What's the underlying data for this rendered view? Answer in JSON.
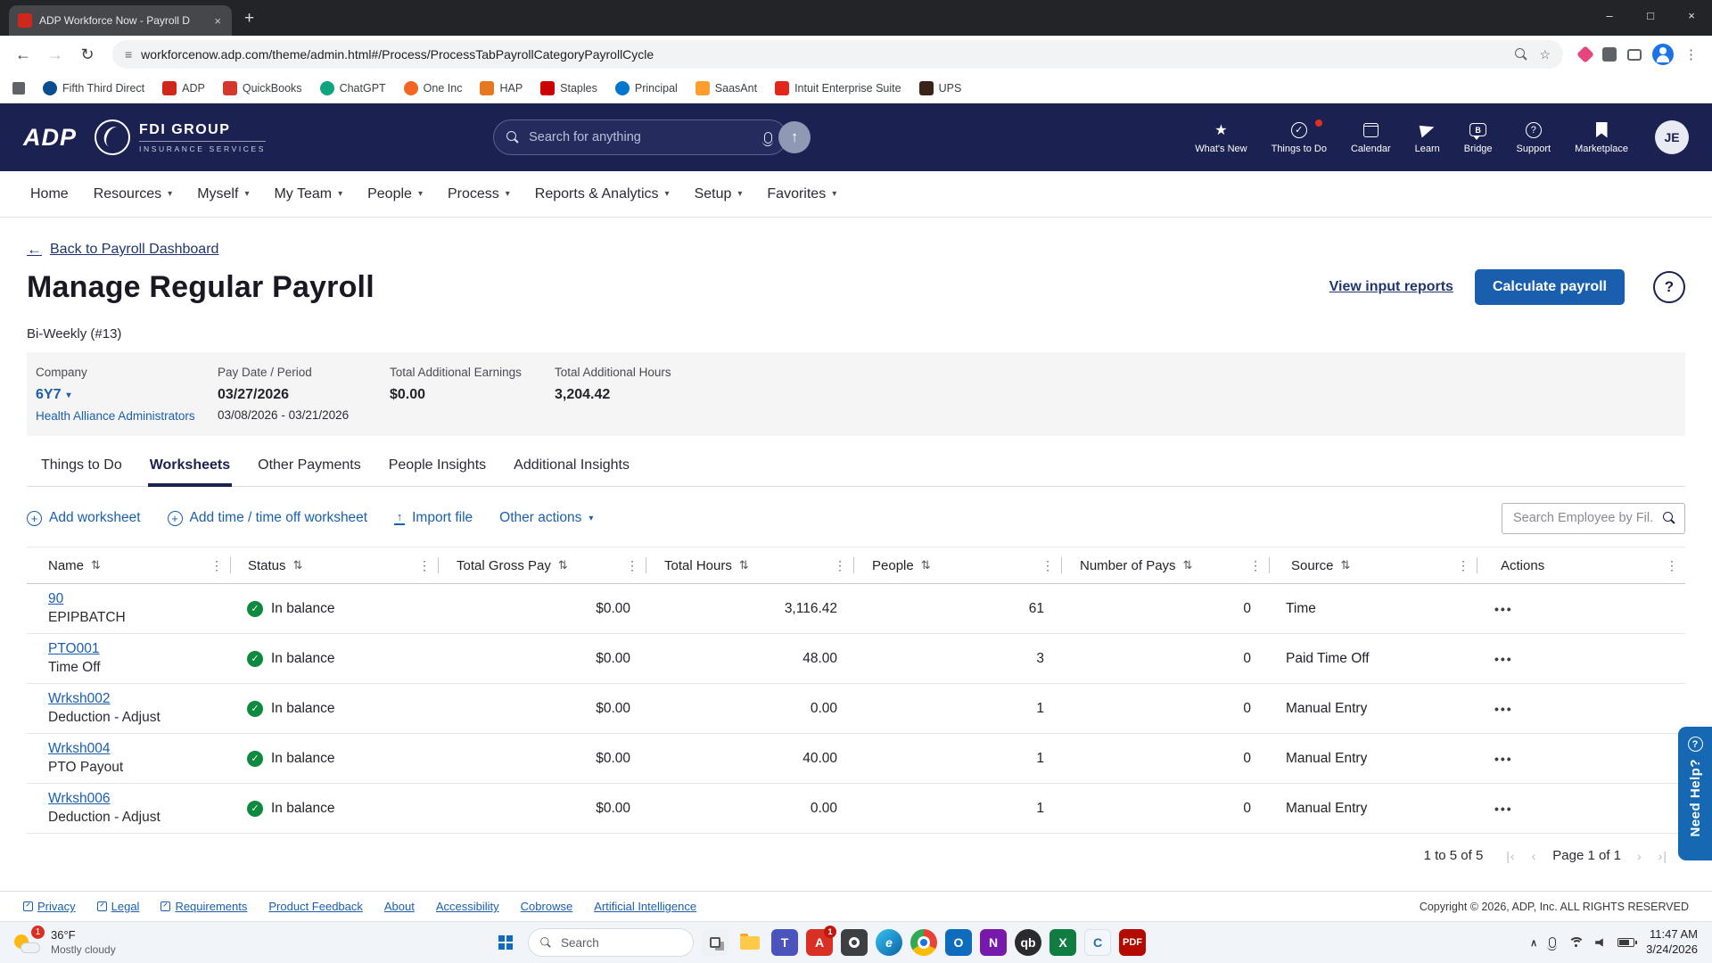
{
  "browser": {
    "tab_title": "ADP Workforce Now - Payroll D",
    "url": "workforcenow.adp.com/theme/admin.html#/Process/ProcessTabPayrollCategoryPayrollCycle"
  },
  "bookmarks": {
    "items": [
      "Fifth Third Direct",
      "ADP",
      "QuickBooks",
      "ChatGPT",
      "One Inc",
      "HAP",
      "Staples",
      "Principal",
      "SaasAnt",
      "Intuit Enterprise Suite",
      "UPS"
    ]
  },
  "header": {
    "logo_text": "ADP",
    "brand_name": "FDI GROUP",
    "brand_tagline": "INSURANCE SERVICES",
    "search_placeholder": "Search for anything",
    "menu": [
      {
        "label": "What's New"
      },
      {
        "label": "Things to Do",
        "has_badge": true
      },
      {
        "label": "Calendar"
      },
      {
        "label": "Learn"
      },
      {
        "label": "Bridge"
      },
      {
        "label": "Support"
      },
      {
        "label": "Marketplace"
      }
    ],
    "avatar_initials": "JE"
  },
  "nav": {
    "items": [
      {
        "label": "Home",
        "caret": false
      },
      {
        "label": "Resources",
        "caret": true
      },
      {
        "label": "Myself",
        "caret": true
      },
      {
        "label": "My Team",
        "caret": true
      },
      {
        "label": "People",
        "caret": true
      },
      {
        "label": "Process",
        "caret": true
      },
      {
        "label": "Reports & Analytics",
        "caret": true
      },
      {
        "label": "Setup",
        "caret": true
      },
      {
        "label": "Favorites",
        "caret": true
      }
    ]
  },
  "page": {
    "back_link": "Back to Payroll Dashboard",
    "title": "Manage Regular Payroll",
    "view_reports_link": "View input reports",
    "calculate_button": "Calculate payroll",
    "cycle_label": "Bi-Weekly (#13)",
    "summary": {
      "company_label": "Company",
      "company_code": "6Y7",
      "company_name": "Health Alliance Administrators",
      "pay_label": "Pay Date / Period",
      "pay_date": "03/27/2026",
      "pay_period": "03/08/2026 - 03/21/2026",
      "earnings_label": "Total Additional Earnings",
      "earnings_value": "$0.00",
      "hours_label": "Total Additional Hours",
      "hours_value": "3,204.42"
    },
    "tabs": [
      {
        "label": "Things to Do"
      },
      {
        "label": "Worksheets"
      },
      {
        "label": "Other Payments"
      },
      {
        "label": "People Insights"
      },
      {
        "label": "Additional Insights"
      }
    ],
    "actions": {
      "add_worksheet": "Add worksheet",
      "add_time": "Add time / time off worksheet",
      "import_file": "Import file",
      "other_actions": "Other actions",
      "search_placeholder": "Search Employee by Fil..."
    },
    "table": {
      "columns": [
        "Name",
        "Status",
        "Total Gross Pay",
        "Total Hours",
        "People",
        "Number of Pays",
        "Source",
        "Actions"
      ],
      "rows": [
        {
          "name": "90",
          "sub": "EPIPBATCH",
          "status": "In balance",
          "gross": "$0.00",
          "hours": "3,116.42",
          "people": "61",
          "pays": "0",
          "source": "Time"
        },
        {
          "name": "PTO001",
          "sub": "Time Off",
          "status": "In balance",
          "gross": "$0.00",
          "hours": "48.00",
          "people": "3",
          "pays": "0",
          "source": "Paid Time Off"
        },
        {
          "name": "Wrksh002",
          "sub": "Deduction - Adjust",
          "status": "In balance",
          "gross": "$0.00",
          "hours": "0.00",
          "people": "1",
          "pays": "0",
          "source": "Manual Entry"
        },
        {
          "name": "Wrksh004",
          "sub": "PTO Payout",
          "status": "In balance",
          "gross": "$0.00",
          "hours": "40.00",
          "people": "1",
          "pays": "0",
          "source": "Manual Entry"
        },
        {
          "name": "Wrksh006",
          "sub": "Deduction - Adjust",
          "status": "In balance",
          "gross": "$0.00",
          "hours": "0.00",
          "people": "1",
          "pays": "0",
          "source": "Manual Entry"
        }
      ]
    },
    "pagination": {
      "range": "1 to 5 of 5",
      "page": "Page 1 of 1"
    },
    "need_help": "Need Help?"
  },
  "footer": {
    "links": [
      "Privacy",
      "Legal",
      "Requirements",
      "Product Feedback",
      "About",
      "Accessibility",
      "Cobrowse",
      "Artificial Intelligence"
    ],
    "copyright": "Copyright © 2026, ADP, Inc. ALL RIGHTS RESERVED"
  },
  "taskbar": {
    "weather_temp": "36°F",
    "weather_desc": "Mostly cloudy",
    "weather_badge": "1",
    "search_placeholder": "Search",
    "app_badge": "1",
    "app_icons": [
      "task-view",
      "file-explorer",
      "teams",
      "adobe-acrobat",
      "settings",
      "edge",
      "chrome",
      "outlook",
      "onenote",
      "quickbooks",
      "excel",
      "calculator",
      "pdf-reader"
    ],
    "time": "11:47 AM",
    "date": "3/24/2026"
  },
  "colors": {
    "header_navy": "#1b2150",
    "link_blue": "#1a5fae",
    "status_green": "#0e8a3e",
    "adp_red": "#d0271c"
  }
}
